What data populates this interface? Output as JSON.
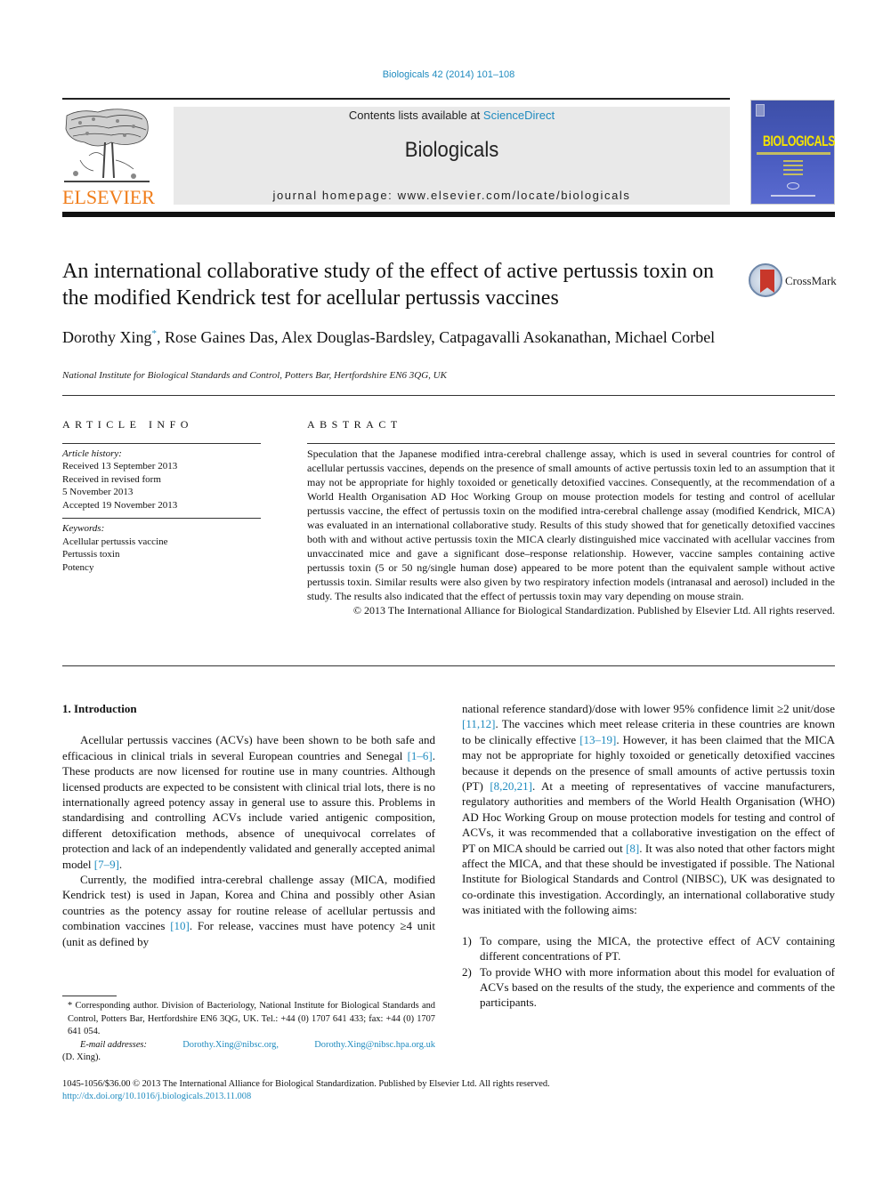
{
  "header": {
    "citation": "Biologicals 42 (2014) 101–108",
    "contents_prefix": "Contents lists available at ",
    "contents_link": "ScienceDirect",
    "journal_name": "Biologicals",
    "homepage_prefix": "journal homepage: ",
    "homepage_url": "www.elsevier.com/locate/biologicals",
    "publisher_logo": "ELSEVIER",
    "cover_title": "BIOLOGICALS",
    "brand_colors": {
      "link": "#1f8bbf",
      "elsevier_orange": "#f07d1a",
      "cover_blue": "#4a5cc0",
      "cover_yellow": "#f5e400"
    }
  },
  "article": {
    "title": "An international collaborative study of the effect of active pertussis toxin on the modified Kendrick test for acellular pertussis vaccines",
    "crossmark_label": "CrossMark",
    "authors_first": "Dorothy Xing",
    "authors_marker": "*",
    "authors_rest": ", Rose Gaines Das, Alex Douglas-Bardsley, Catpagavalli Asokanathan, Michael Corbel",
    "affiliation": "National Institute for Biological Standards and Control, Potters Bar, Hertfordshire EN6 3QG, UK"
  },
  "article_info": {
    "heading": "ARTICLE INFO",
    "history_label": "Article history:",
    "history": [
      "Received 13 September 2013",
      "Received in revised form",
      "5 November 2013",
      "Accepted 19 November 2013"
    ],
    "keywords_label": "Keywords:",
    "keywords": [
      "Acellular pertussis vaccine",
      "Pertussis toxin",
      "Potency"
    ]
  },
  "abstract": {
    "heading": "ABSTRACT",
    "text": "Speculation that the Japanese modified intra-cerebral challenge assay, which is used in several countries for control of acellular pertussis vaccines, depends on the presence of small amounts of active pertussis toxin led to an assumption that it may not be appropriate for highly toxoided or genetically detoxified vaccines. Consequently, at the recommendation of a World Health Organisation AD Hoc Working Group on mouse protection models for testing and control of acellular pertussis vaccine, the effect of pertussis toxin on the modified intra-cerebral challenge assay (modified Kendrick, MICA) was evaluated in an international collaborative study. Results of this study showed that for genetically detoxified vaccines both with and without active pertussis toxin the MICA clearly distinguished mice vaccinated with acellular vaccines from unvaccinated mice and gave a significant dose–response relationship. However, vaccine samples containing active pertussis toxin (5 or 50 ng/single human dose) appeared to be more potent than the equivalent sample without active pertussis toxin. Similar results were also given by two respiratory infection models (intranasal and aerosol) included in the study. The results also indicated that the effect of pertussis toxin may vary depending on mouse strain.",
    "copyright": "© 2013 The International Alliance for Biological Standardization. Published by Elsevier Ltd. All rights reserved."
  },
  "body": {
    "section_heading": "1.  Introduction",
    "p1_a": "Acellular pertussis vaccines (ACVs) have been shown to be both safe and efficacious in clinical trials in several European countries and Senegal ",
    "p1_ref1": "[1–6]",
    "p1_b": ". These products are now licensed for routine use in many countries. Although licensed products are expected to be consistent with clinical trial lots, there is no internationally agreed potency assay in general use to assure this. Problems in standardising and controlling ACVs include varied antigenic composition, different detoxification methods, absence of unequivocal correlates of protection and lack of an independently validated and generally accepted animal model ",
    "p1_ref2": "[7–9]",
    "p1_c": ".",
    "p2_a": "Currently, the modified intra-cerebral challenge assay (MICA, modified Kendrick test) is used in Japan, Korea and China and possibly other Asian countries as the potency assay for routine release of acellular pertussis and combination vaccines ",
    "p2_ref1": "[10]",
    "p2_b": ". For release, vaccines must have potency ≥4 unit (unit as defined by",
    "r_a": "national reference standard)/dose with lower 95% confidence limit ≥2 unit/dose ",
    "r_ref1": "[11,12]",
    "r_b": ". The vaccines which meet release criteria in these countries are known to be clinically effective ",
    "r_ref2": "[13–19]",
    "r_c": ". However, it has been claimed that the MICA may not be appropriate for highly toxoided or genetically detoxified vaccines because it depends on the presence of small amounts of active pertussis toxin (PT) ",
    "r_ref3": "[8,20,21]",
    "r_d": ". At a meeting of representatives of vaccine manufacturers, regulatory authorities and members of the World Health Organisation (WHO) AD Hoc Working Group on mouse protection models for testing and control of ACVs, it was recommended that a collaborative investigation on the effect of PT on MICA should be carried out ",
    "r_ref4": "[8]",
    "r_e": ". It was also noted that other factors might affect the MICA, and that these should be investigated if possible. The National Institute for Biological Standards and Control (NIBSC), UK was designated to co-ordinate this investigation. Accordingly, an international collaborative study was initiated with the following aims:",
    "aims": [
      {
        "num": "1)",
        "text": "To compare, using the MICA, the protective effect of ACV containing different concentrations of PT."
      },
      {
        "num": "2)",
        "text": "To provide WHO with more information about this model for evaluation of ACVs based on the results of the study, the experience and comments of the participants."
      }
    ]
  },
  "footnote": {
    "marker": "*",
    "text": " Corresponding author. Division of Bacteriology, National Institute for Biological Standards and Control, Potters Bar, Hertfordshire EN6 3QG, UK. Tel.: +44 (0) 1707 641 433; fax: +44 (0) 1707 641 054.",
    "email_label": "E-mail addresses:",
    "email_1": "Dorothy.Xing@nibsc.org,",
    "email_2": "Dorothy.Xing@nibsc.hpa.org.uk",
    "email_owner": "(D. Xing)."
  },
  "footer": {
    "copyright": "1045-1056/$36.00 © 2013 The International Alliance for Biological Standardization. Published by Elsevier Ltd. All rights reserved.",
    "doi": "http://dx.doi.org/10.1016/j.biologicals.2013.11.008"
  }
}
